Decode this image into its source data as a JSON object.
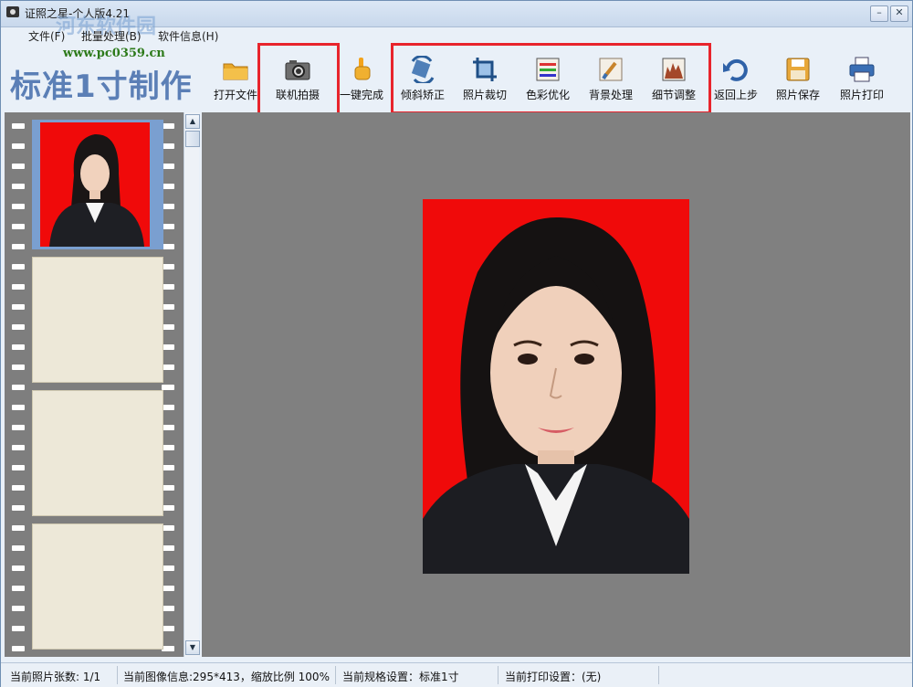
{
  "window": {
    "title": "证照之星-个人版4.21"
  },
  "watermark": {
    "text": "河东软件园",
    "url": "www.pc0359.cn"
  },
  "menu": {
    "items": [
      "文件(F)",
      "批量处理(B)",
      "软件信息(H)"
    ]
  },
  "toolbar": {
    "heading": "标准1寸制作",
    "buttons": [
      {
        "label": "打开文件",
        "icon": "folder-icon"
      },
      {
        "label": "联机拍摄",
        "icon": "camera-icon"
      },
      {
        "label": "一键完成",
        "icon": "hand-pointer-icon"
      },
      {
        "label": "倾斜矫正",
        "icon": "rotate-icon"
      },
      {
        "label": "照片裁切",
        "icon": "crop-icon"
      },
      {
        "label": "色彩优化",
        "icon": "color-bars-icon"
      },
      {
        "label": "背景处理",
        "icon": "brush-icon"
      },
      {
        "label": "细节调整",
        "icon": "detail-chart-icon"
      },
      {
        "label": "返回上步",
        "icon": "undo-icon"
      },
      {
        "label": "照片保存",
        "icon": "floppy-disk-icon"
      },
      {
        "label": "照片打印",
        "icon": "printer-icon"
      }
    ]
  },
  "colors": {
    "photo_background": "#f00a0a",
    "highlight": "#e8242c",
    "canvas": "#808080"
  },
  "status": {
    "count": "当前照片张数: 1/1",
    "image_info": "当前图像信息:295*413，缩放比例 100%",
    "spec": "当前规格设置：标准1寸",
    "print": "当前打印设置：(无)"
  }
}
